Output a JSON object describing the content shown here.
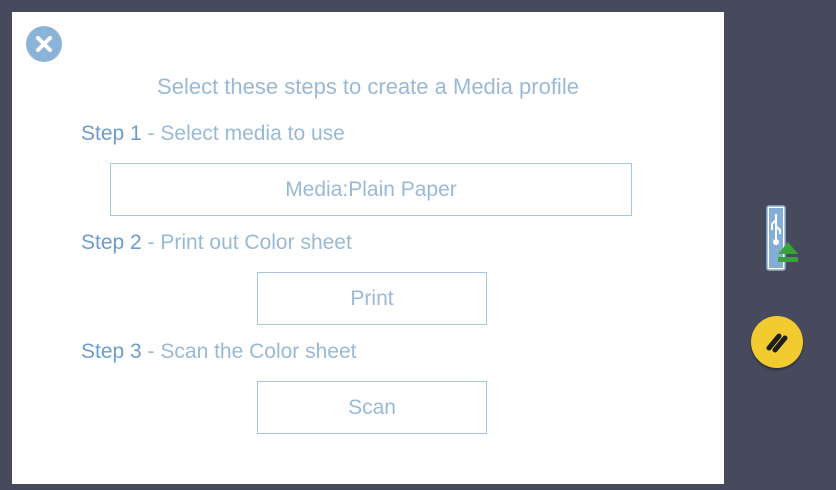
{
  "dialog": {
    "heading": "Select these steps to create a Media profile",
    "steps": [
      {
        "number": "Step 1",
        "text": " - Select media to use",
        "button": "Media:Plain Paper"
      },
      {
        "number": "Step 2",
        "text": " - Print out Color sheet",
        "button": "Print"
      },
      {
        "number": "Step 3",
        "text": " - Scan the Color sheet",
        "button": "Scan"
      }
    ],
    "close_icon": "close-icon"
  },
  "side": {
    "usb_icon": "usb-eject-icon",
    "tool_icon": "pencil-tool-icon"
  },
  "colors": {
    "background": "#474a5d",
    "accent": "#6d9ccc",
    "text": "#9ab9d6",
    "yellow": "#f1cb2f"
  }
}
